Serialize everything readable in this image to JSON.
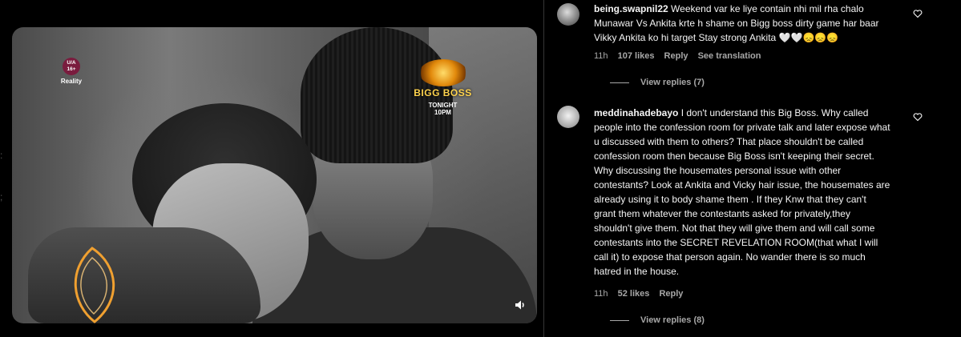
{
  "media": {
    "rating": {
      "line1": "U/A",
      "line2": "16+",
      "genre": "Reality"
    },
    "logo": {
      "title": "BIGG BOSS",
      "tonight": "TONIGHT",
      "time": "10PM"
    },
    "icons": {
      "volume": "volume-icon",
      "corner": "channel-mark-icon"
    }
  },
  "comments": [
    {
      "username": "being.swapnil22",
      "text": "Weekend var ke liye contain nhi mil rha chalo Munawar Vs Ankita krte h shame on Bigg boss dirty game har baar Vikky Ankita ko hi target Stay strong Ankita 🤍🤍😞😞😞",
      "time": "11h",
      "likes": "107 likes",
      "reply": "Reply",
      "translate": "See translation",
      "view_replies": "View replies (7)"
    },
    {
      "username": "meddinahadebayo",
      "text": "I don't understand this Big Boss. Why called people into the confession room for private talk and later expose what u discussed with them to others? That place shouldn't be called confession room then because Big Boss isn't keeping their secret. Why discussing the housemates personal issue with other contestants? Look at Ankita and Vicky hair issue, the housemates are already using it to body shame them . If they Knw that they can't grant them whatever the contestants asked for privately,they shouldn't give them. Not that they will give them and will call some contestants into the SECRET REVELATION ROOM(that what I will call it) to expose that person again. No wander there is so much hatred in the house.",
      "time": "11h",
      "likes": "52 likes",
      "reply": "Reply",
      "view_replies": "View replies (8)"
    }
  ],
  "colors": {
    "background": "#000000",
    "text": "#f5f5f5",
    "muted": "#a8a8a8",
    "divider": "#363636",
    "logo_gold": "#ffd34d"
  }
}
